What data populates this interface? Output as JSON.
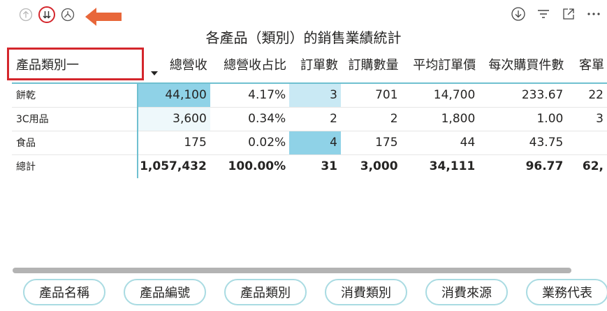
{
  "visual": {
    "title": "各產品（類別）的銷售業績統計"
  },
  "table": {
    "columns": [
      "產品類別一",
      "總營收",
      "總營收占比",
      "訂單數",
      "訂購數量",
      "平均訂單價",
      "每次購買件數",
      "客單"
    ],
    "rows": [
      {
        "cells": [
          "餅乾",
          "44,100",
          "4.17%",
          "3",
          "701",
          "14,700",
          "233.67",
          "22"
        ]
      },
      {
        "cells": [
          "3C用品",
          "3,600",
          "0.34%",
          "2",
          "2",
          "1,800",
          "1.00",
          "3"
        ]
      },
      {
        "cells": [
          "食品",
          "175",
          "0.02%",
          "4",
          "175",
          "44",
          "43.75",
          ""
        ]
      }
    ],
    "total": {
      "cells": [
        "總計",
        "1,057,432",
        "100.00%",
        "31",
        "3,000",
        "34,111",
        "96.77",
        "62,"
      ]
    }
  },
  "chips": [
    {
      "label": "產品名稱"
    },
    {
      "label": "產品編號"
    },
    {
      "label": "產品類別"
    },
    {
      "label": "消費類別"
    },
    {
      "label": "消費來源"
    },
    {
      "label": "業務代表"
    }
  ],
  "colors": {
    "accent": "#6fc0d0",
    "highlight": "#d4262c",
    "arrow": "#e8673a",
    "cell_dark": "#8fd2e7",
    "cell_light": "#c9e9f4",
    "cell_faint": "#eef8fb"
  },
  "icons": {
    "top_left": [
      "drill-up-icon",
      "expand-next-level-icon",
      "drill-down-icon"
    ],
    "top_right": [
      "download-icon",
      "filter-icon",
      "focus-mode-icon",
      "more-options-icon"
    ]
  }
}
